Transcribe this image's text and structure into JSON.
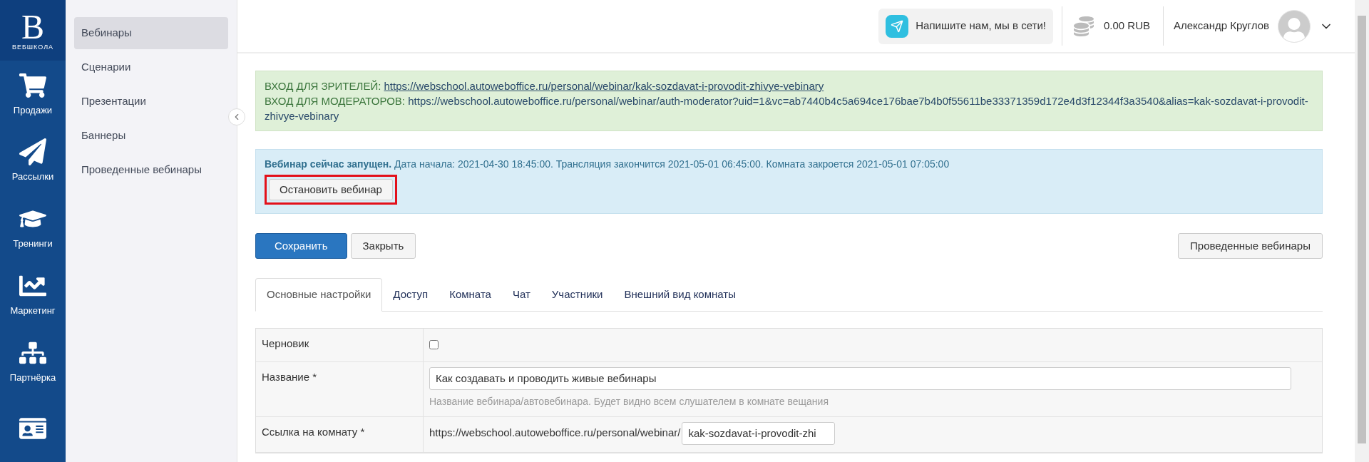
{
  "rail": {
    "logo": {
      "letter": "В",
      "caption": "ВЕБШКОЛА"
    },
    "items": [
      {
        "kind": "cart",
        "label": "Продажи",
        "selected": false
      },
      {
        "kind": "plane",
        "label": "Рассылки",
        "selected": false
      },
      {
        "kind": "cap",
        "label": "Тренинги",
        "selected": false
      },
      {
        "kind": "chart",
        "label": "Маркетинг",
        "selected": false
      },
      {
        "kind": "network",
        "label": "Партнёрка",
        "selected": false
      },
      {
        "kind": "card",
        "selected": false
      }
    ]
  },
  "submenu": {
    "items": [
      {
        "label": "Вебинары",
        "selected": true
      },
      {
        "label": "Сценарии",
        "selected": false
      },
      {
        "label": "Презентации",
        "selected": false
      },
      {
        "label": "Баннеры",
        "selected": false
      },
      {
        "label": "Проведенные вебинары",
        "selected": false
      }
    ]
  },
  "header": {
    "chat": "Напишите нам, мы в сети!",
    "balance": "0.00 RUB",
    "user": "Александр Круглов"
  },
  "links_box": {
    "viewers_label": "ВХОД ДЛЯ ЗРИТЕЛЕЙ:",
    "viewers_url": "https://webschool.autoweboffice.ru/personal/webinar/kak-sozdavat-i-provodit-zhivye-vebinary",
    "moderators_label": "ВХОД ДЛЯ МОДЕРАТОРОВ:",
    "moderators_url": "https://webschool.autoweboffice.ru/personal/webinar/auth-moderator?uid=1&vc=ab7440b4c5a694ce176bae7b4b0f55611be33371359d172e4d3f12344f3a3540&alias=kak-sozdavat-i-provodit-zhivye-vebinary"
  },
  "status_box": {
    "text": "**Вебинар сейчас запущен.** Дата начала: 2021-04-30 18:45:00. Трансляция закончится 2021-05-01 06:45:00. Комната закроется 2021-05-01 07:05:00",
    "button": "Остановить вебинар"
  },
  "actions": {
    "save": "Сохранить",
    "close": "Закрыть",
    "history": "Проведенные вебинары"
  },
  "tabs": [
    {
      "label": "Основные настройки",
      "selected": true
    },
    {
      "label": "Доступ",
      "selected": false
    },
    {
      "label": "Комната",
      "selected": false
    },
    {
      "label": "Чат",
      "selected": false
    },
    {
      "label": "Участники",
      "selected": false
    },
    {
      "label": "Внешний вид комнаты",
      "selected": false
    }
  ],
  "form": [
    {
      "kind": "checkbox",
      "label": "Черновик",
      "checked": false
    },
    {
      "kind": "text",
      "label": "Название *",
      "value": "Как создавать и проводить живые вебинары",
      "hint": "Название вебинара/автовебинара. Будет видно всем слушателем в комнате вещания"
    },
    {
      "kind": "url",
      "label": "Ссылка на комнату *",
      "prefix": "https://webschool.autoweboffice.ru/personal/webinar/",
      "value": "kak-sozdavat-i-provodit-zhi"
    }
  ]
}
